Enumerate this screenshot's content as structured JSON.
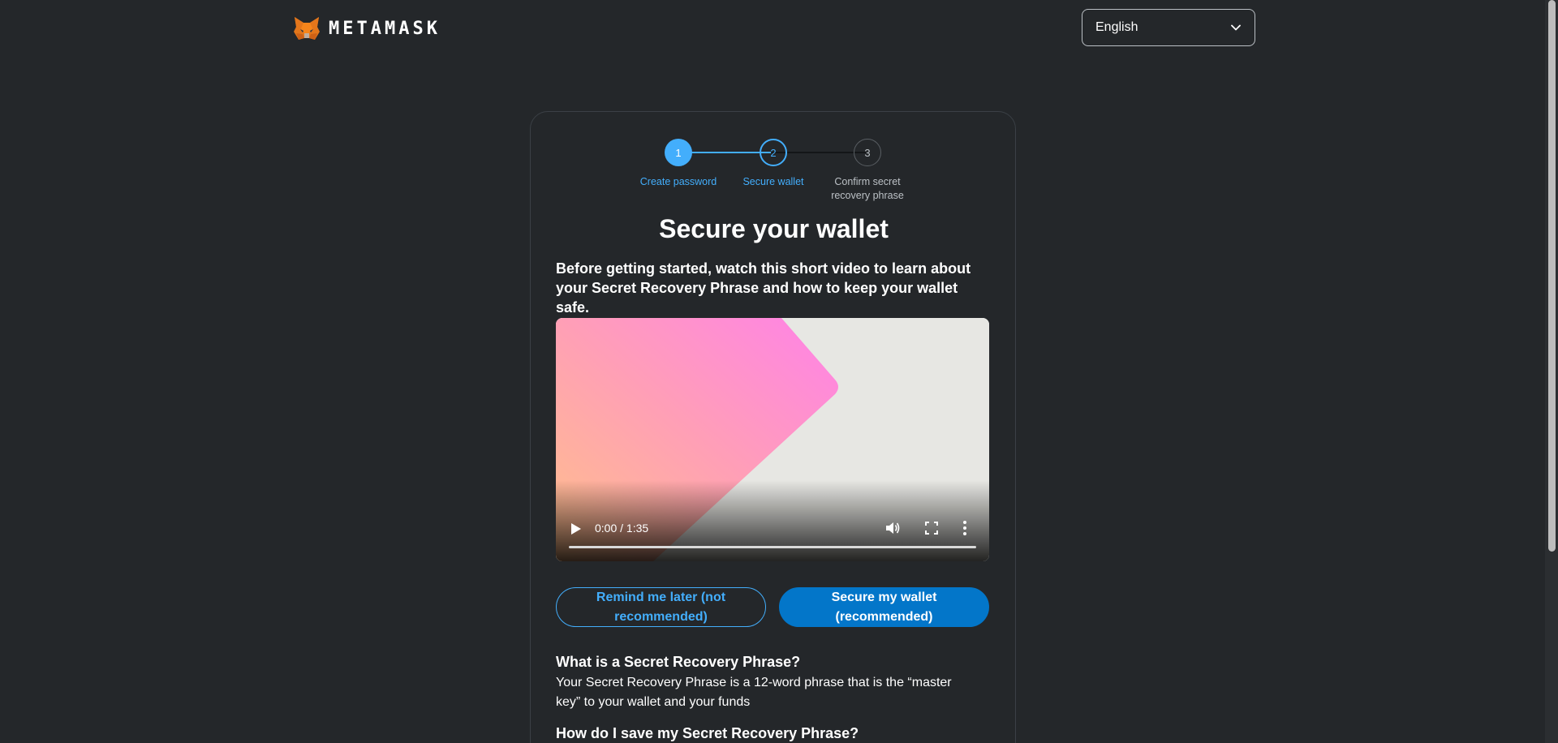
{
  "header": {
    "brand": "METAMASK",
    "language_selected": "English"
  },
  "stepper": {
    "steps": [
      {
        "number": "1",
        "label": "Create password",
        "state": "complete"
      },
      {
        "number": "2",
        "label": "Secure wallet",
        "state": "active"
      },
      {
        "number": "3",
        "label": "Confirm secret recovery phrase",
        "state": "inactive"
      }
    ]
  },
  "main": {
    "title": "Secure your wallet",
    "intro": "Before getting started, watch this short video to learn about your Secret Recovery Phrase and how to keep your wallet safe."
  },
  "video": {
    "time": "0:00 / 1:35",
    "progress": 0
  },
  "buttons": {
    "remind_later": "Remind me later (not recommended)",
    "secure_wallet": "Secure my wallet (recommended)"
  },
  "faq": [
    {
      "question": "What is a Secret Recovery Phrase?",
      "answer": "Your Secret Recovery Phrase is a 12-word phrase that is the “master key” to your wallet and your funds"
    },
    {
      "question": "How do I save my Secret Recovery Phrase?",
      "answer": ""
    }
  ],
  "colors": {
    "background": "#24272a",
    "accent": "#43aefc",
    "primary_button": "#0376c9",
    "inactive": "#bbc0c5"
  },
  "icons": {
    "logo": "metamask-fox-icon",
    "language_chevron": "chevron-down-icon",
    "play": "play-icon",
    "volume": "volume-icon",
    "fullscreen": "fullscreen-icon",
    "more": "more-vertical-icon"
  }
}
